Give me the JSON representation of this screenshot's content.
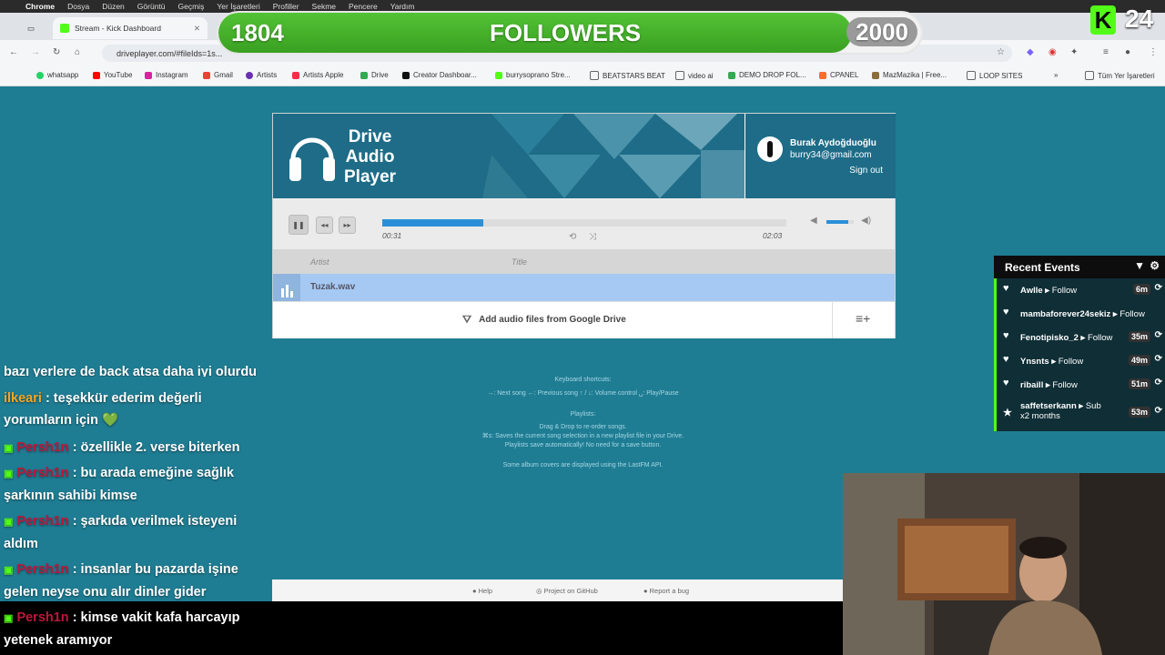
{
  "menubar": {
    "items": [
      "Chrome",
      "Dosya",
      "Düzen",
      "Görüntü",
      "Geçmiş",
      "Yer İşaretleri",
      "Profiller",
      "Sekme",
      "Pencere",
      "Yardım"
    ]
  },
  "tabs": [
    {
      "label": "Stream - Kick Dashboard"
    }
  ],
  "address": {
    "url": "driveplayer.com/#fileIds=1s..."
  },
  "bookmarks": [
    "whatsapp",
    "YouTube",
    "Instagram",
    "Gmail",
    "Artists",
    "Artists Apple",
    "Drive",
    "Creator Dashboar...",
    "burrysoprano Stre...",
    "BEATSTARS BEAT",
    "video ai",
    "DEMO DROP FOL...",
    "CPANEL",
    "MazMazika | Free...",
    "LOOP SITES",
    "Tüm Yer İşaretleri"
  ],
  "followers": {
    "current": "1804",
    "label": "FOLLOWERS",
    "goal": "2000",
    "progress": 0.902
  },
  "kick_badge": {
    "number": "24"
  },
  "player": {
    "logo_lines": [
      "Drive",
      "Audio",
      "Player"
    ],
    "user": {
      "name": "Burak Aydoğduoğlu",
      "email": "burry34@gmail.com",
      "signout": "Sign out"
    },
    "elapsed": "00:31",
    "duration": "02:03",
    "progress": 0.25,
    "volume": 0.8,
    "columns": {
      "artist": "Artist",
      "title": "Title"
    },
    "track": "Tuzak.wav",
    "add_label": "Add audio files from Google Drive"
  },
  "info": {
    "shortcuts_title": "Keyboard shortcuts:",
    "shortcuts": "→: Next song  ←: Previous song  ↑ / ↓: Volume control  ␣: Play/Pause",
    "playlists_title": "Playlists:",
    "playlists_1": "Drag & Drop to re-order songs.",
    "playlists_2": "⌘s: Saves the current song selection in a new playlist file in your Drive.",
    "playlists_3": "Playlists save automatically! No need for a save button.",
    "album_note": "Some album covers are displayed using the LastFM API."
  },
  "footer": {
    "help": "Help",
    "github": "Project on GitHub",
    "bug": "Report a bug"
  },
  "chat": [
    {
      "user": "",
      "text": "bazı yerlere de back atsa daha iyi olurdu"
    },
    {
      "user": "ilkeari",
      "text": ": teşekkür ederim değerli yorumların için 💚",
      "user_color": "#f5a623"
    },
    {
      "user": "Persh1n",
      "text": ": özellikle 2. verse biterken"
    },
    {
      "user": "Persh1n",
      "text": ": bu arada emeğine sağlık şarkının sahibi kimse"
    },
    {
      "user": "Persh1n",
      "text": ": şarkıda verilmek isteyeni aldım"
    },
    {
      "user": "Persh1n",
      "text": ": insanlar bu pazarda işine gelen neyse onu alır dinler gider"
    },
    {
      "user": "Persh1n",
      "text": ": kimse vakit kafa harcayıp yetenek aramıyor"
    }
  ],
  "events": {
    "title": "Recent Events",
    "items": [
      {
        "name": "Awlle",
        "action": "Follow",
        "time": "6m"
      },
      {
        "name": "mambaforever24sekiz",
        "action": "Follow",
        "time": ""
      },
      {
        "name": "Fenotipisko_2",
        "action": "Follow",
        "time": "35m"
      },
      {
        "name": "Ynsnts",
        "action": "Follow",
        "time": "49m"
      },
      {
        "name": "ribaill",
        "action": "Follow",
        "time": "51m"
      },
      {
        "name": "saffetserkann",
        "action": "Sub",
        "extra": "x2 months",
        "time": "53m"
      }
    ]
  },
  "colors": {
    "accent": "#53fc18",
    "bg": "#1f7d93",
    "progress": "#2b8fd8"
  }
}
